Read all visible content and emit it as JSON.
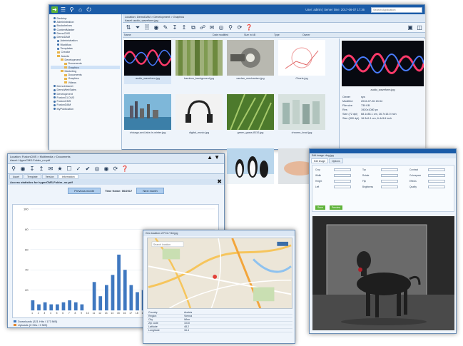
{
  "main": {
    "user_label": "User: admin | Server time: 2017-06-07 17:36",
    "search_placeholder": "Search Application",
    "location": "Location: DemoDAM > Development > Graphics",
    "asset": "Asset: audio_waveform.jpg",
    "tree": [
      {
        "label": "Desktop",
        "indent": 0,
        "kind": "bullet"
      },
      {
        "label": "Administration",
        "indent": 0,
        "kind": "bullet"
      },
      {
        "label": "Bookshelves",
        "indent": 0,
        "kind": "bullet"
      },
      {
        "label": "ContentMaster",
        "indent": 0,
        "kind": "bullet"
      },
      {
        "label": "DemoCMS",
        "indent": 0,
        "kind": "bullet"
      },
      {
        "label": "DemoDAM",
        "indent": 0,
        "kind": "bullet"
      },
      {
        "label": "Administration",
        "indent": 1,
        "kind": "bullet"
      },
      {
        "label": "Workflow",
        "indent": 1,
        "kind": "bullet"
      },
      {
        "label": "Templates",
        "indent": 1,
        "kind": "bullet"
      },
      {
        "label": "Creator",
        "indent": 1,
        "kind": "folder"
      },
      {
        "label": "Assets",
        "indent": 1,
        "kind": "folder"
      },
      {
        "label": "Development",
        "indent": 2,
        "kind": "folder"
      },
      {
        "label": "Documents",
        "indent": 3,
        "kind": "folder"
      },
      {
        "label": "Graphics",
        "indent": 3,
        "kind": "folder",
        "selected": true
      },
      {
        "label": "Marketing",
        "indent": 2,
        "kind": "folder"
      },
      {
        "label": "Documents",
        "indent": 3,
        "kind": "folder"
      },
      {
        "label": "Graphics",
        "indent": 3,
        "kind": "folder"
      },
      {
        "label": "Videos",
        "indent": 3,
        "kind": "folder"
      },
      {
        "label": "DemoIntranet",
        "indent": 0,
        "kind": "bullet"
      },
      {
        "label": "DemoWebSales",
        "indent": 0,
        "kind": "bullet"
      },
      {
        "label": "Development",
        "indent": 0,
        "kind": "bullet"
      },
      {
        "label": "FusionCLOUD",
        "indent": 0,
        "kind": "bullet"
      },
      {
        "label": "FusionCMS",
        "indent": 0,
        "kind": "bullet"
      },
      {
        "label": "FusionDAM",
        "indent": 0,
        "kind": "bullet"
      },
      {
        "label": "MyPublication",
        "indent": 0,
        "kind": "bullet"
      }
    ],
    "columns": [
      "Name",
      "Date modified",
      "Size in kB",
      "Type",
      "Owner"
    ],
    "thumbs": [
      {
        "caption": "audio_waveform.jpg",
        "style": "waveform",
        "selected": true
      },
      {
        "caption": "bamboo_background.jpg",
        "style": "bamboo"
      },
      {
        "caption": "cardan_mechanism.jpg",
        "style": "mechanism"
      },
      {
        "caption": "Charts.jpg",
        "style": "chartsketch"
      },
      {
        "caption": "chicago-and-lake-in-winter.jpg",
        "style": "city"
      },
      {
        "caption": "digital_music.jpg",
        "style": "headphones"
      },
      {
        "caption": "green_grass-8110.jpg",
        "style": "grass"
      },
      {
        "caption": "chrome_bowl.jpg",
        "style": "bottles"
      },
      {
        "caption": "",
        "style": "penguins"
      },
      {
        "caption": "",
        "style": "hand"
      }
    ],
    "preview": {
      "name": "audio_waveform.jpg",
      "meta": [
        {
          "k": "Owner",
          "v": "sys"
        },
        {
          "k": "Modified",
          "v": "2016-07-26 15:34"
        },
        {
          "k": "File size",
          "v": "739 KB"
        },
        {
          "k": "Res",
          "v": "1920x1080 px"
        },
        {
          "k": "Size (72 dpi)",
          "v": "68.1x38.1 cm, 26.7x15.0 inch"
        },
        {
          "k": "Size (300 dpi)",
          "v": "16.3x9.1 cm, 6.4x3.6 inch"
        }
      ]
    }
  },
  "stats": {
    "location": "Location: FusionCMS > Multimedia > Documents",
    "asset": "Asset: HyperCMS-Folder_no.pdf",
    "tabs": [
      "Asset",
      "Template",
      "Version",
      "Information"
    ],
    "title": "Access statistics for hyperCMS-Folder_no.pdf",
    "prev_label": "Previous month",
    "period_label": "Time frame: 06/2017",
    "next_label": "Next month",
    "legend": [
      "Downloads (321 Hits / 173 MB)",
      "Uploads (0 Hits / 0 MB)"
    ]
  },
  "chart_data": {
    "type": "bar",
    "categories": [
      "1",
      "2",
      "3",
      "4",
      "5",
      "6",
      "7",
      "8",
      "9",
      "10",
      "11",
      "12",
      "13",
      "14",
      "15",
      "16",
      "17",
      "18",
      "19",
      "20",
      "21",
      "22",
      "23",
      "24",
      "25",
      "26",
      "27",
      "28",
      "29",
      "30"
    ],
    "series": [
      {
        "name": "Downloads (321 Hits / 173 MB)",
        "values": [
          10,
          6,
          8,
          6,
          6,
          8,
          10,
          8,
          6,
          0,
          28,
          14,
          25,
          35,
          55,
          40,
          25,
          18,
          20,
          17,
          10,
          6,
          8,
          5,
          3,
          2,
          0,
          0,
          0,
          0
        ]
      },
      {
        "name": "Uploads (0 Hits / 0 MB)",
        "values": [
          0,
          0,
          0,
          0,
          0,
          0,
          0,
          0,
          0,
          0,
          0,
          0,
          0,
          0,
          0,
          0,
          0,
          0,
          0,
          0,
          0,
          0,
          0,
          0,
          0,
          0,
          0,
          0,
          0,
          0
        ]
      }
    ],
    "ylim": [
      0,
      100
    ],
    "yticks": [
      "100",
      "80",
      "60",
      "40",
      "20"
    ],
    "colors": {
      "downloads": "#3f78c0",
      "uploads": "#e4862d"
    }
  },
  "map_win": {
    "title": "Geo location of FC2-Y18.jpg",
    "search": "Search location",
    "rows": [
      {
        "k": "Country",
        "v": "Austria"
      },
      {
        "k": "Region",
        "v": "Vienna"
      },
      {
        "k": "City",
        "v": "Wien"
      },
      {
        "k": "Zip code",
        "v": "1010"
      },
      {
        "k": "Latitude",
        "v": "48.2"
      },
      {
        "k": "Longitude",
        "v": "16.4"
      }
    ]
  },
  "img_win": {
    "title": "Edit image: dog.jpg",
    "tabs": [
      "Edit image",
      "Options"
    ],
    "fields": [
      "Crop",
      "Width",
      "Height",
      "Left",
      "Top",
      "Rotate",
      "Flip",
      "Brightness",
      "Contrast",
      "Colorspace",
      "Effects",
      "Quality"
    ],
    "save": "Save",
    "cancel": "Preview"
  }
}
